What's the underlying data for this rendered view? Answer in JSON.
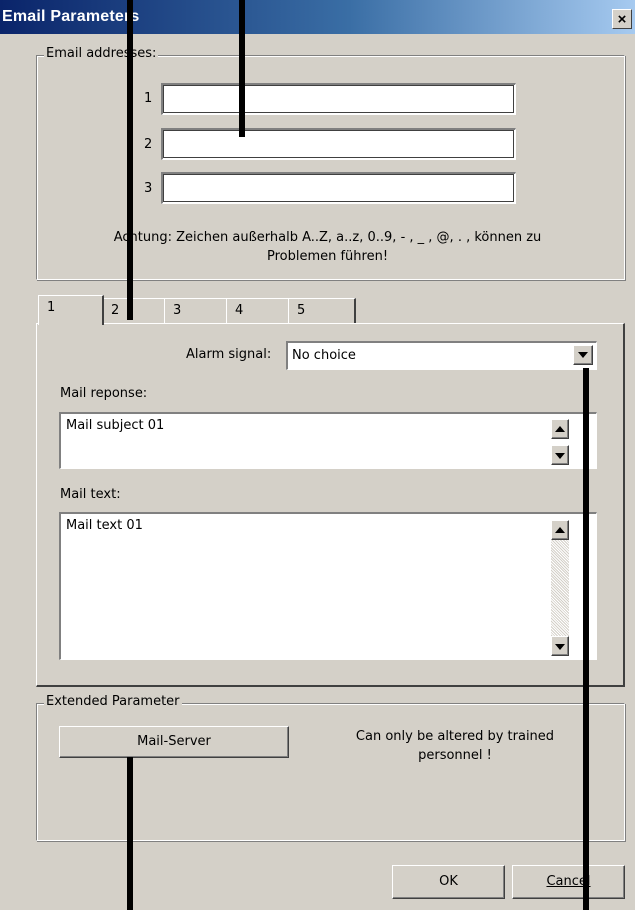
{
  "window": {
    "title": "Email Parameters",
    "close_glyph": "×"
  },
  "email_group": {
    "legend": "Email addresses:",
    "rows": [
      {
        "label": "1",
        "value": ""
      },
      {
        "label": "2",
        "value": ""
      },
      {
        "label": "3",
        "value": ""
      }
    ],
    "warning_line1": "Achtung: Zeichen außerhalb A..Z, a..z, 0..9, - , _ , @, . , können zu",
    "warning_line2": "Problemen führen!"
  },
  "tabs": [
    {
      "label": "1",
      "active": true
    },
    {
      "label": "2",
      "active": false
    },
    {
      "label": "3",
      "active": false
    },
    {
      "label": "4",
      "active": false
    },
    {
      "label": "5",
      "active": false
    }
  ],
  "tab_panel": {
    "alarm_label": "Alarm signal:",
    "alarm_value": "No choice",
    "mail_response_label": "Mail reponse:",
    "mail_subject": "Mail subject 01",
    "mail_text_label": "Mail text:",
    "mail_text": "Mail text 01"
  },
  "extended_group": {
    "legend": "Extended Parameter",
    "mail_server_button": "Mail-Server",
    "note_line1": "Can only be altered by trained",
    "note_line2": "personnel !"
  },
  "footer": {
    "ok_label": "OK",
    "cancel_label": "Cancel"
  },
  "colors": {
    "dialog_bg": "#d4d0c8",
    "titlebar_start": "#0a246a",
    "titlebar_end": "#a6caf0"
  }
}
